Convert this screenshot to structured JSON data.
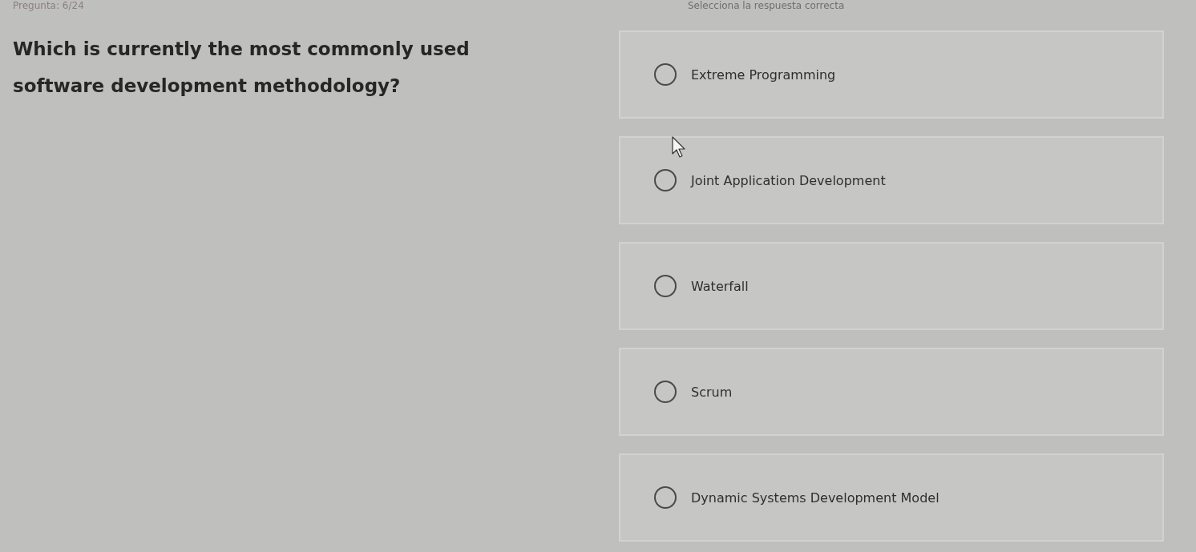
{
  "header": {
    "progress": "Pregunta: 6/24",
    "instruction": "Selecciona la respuesta correcta"
  },
  "question": {
    "text": "Which is currently the most commonly used software development methodology?"
  },
  "options": [
    {
      "label": "Extreme Programming",
      "selected": false
    },
    {
      "label": "Joint Application Development",
      "selected": false
    },
    {
      "label": "Waterfall",
      "selected": false
    },
    {
      "label": "Scrum",
      "selected": false
    },
    {
      "label": "Dynamic Systems Development Model",
      "selected": false
    }
  ]
}
